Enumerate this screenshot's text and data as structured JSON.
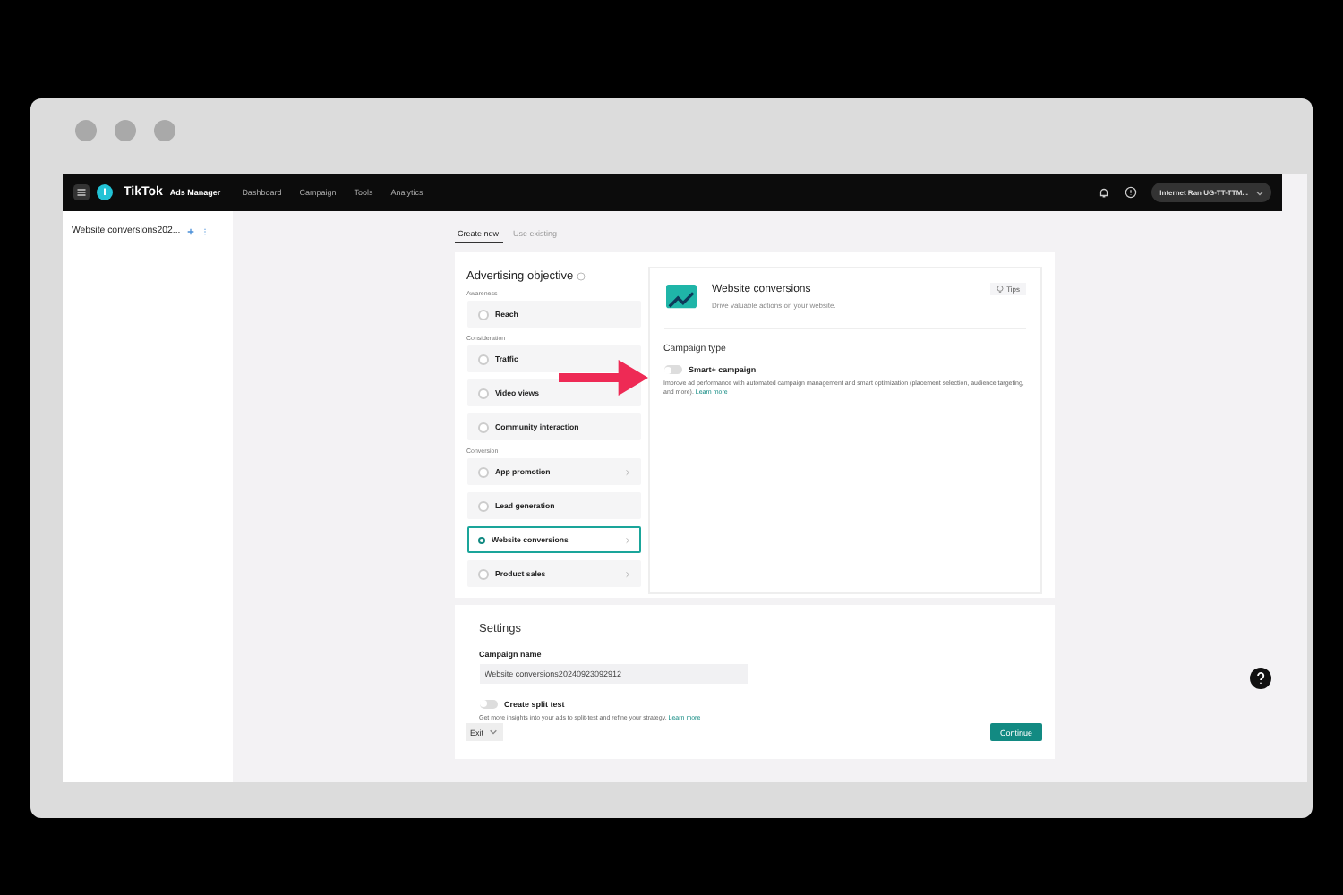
{
  "nav": {
    "brand": "TikTok",
    "product": "Ads Manager",
    "items": [
      "Dashboard",
      "Campaign",
      "Tools",
      "Analytics"
    ],
    "account": "Internet Ran UG-TT-TTM..."
  },
  "sidebar": {
    "campaign": "Website conversions202..."
  },
  "tabs": [
    {
      "label": "Create new",
      "selected": true
    },
    {
      "label": "Use existing",
      "selected": false
    }
  ],
  "objective": {
    "title": "Advertising objective",
    "groups": [
      {
        "label": "Awareness",
        "options": [
          {
            "label": "Reach",
            "selected": false,
            "expandable": false
          }
        ]
      },
      {
        "label": "Consideration",
        "options": [
          {
            "label": "Traffic",
            "selected": false,
            "expandable": false
          },
          {
            "label": "Video views",
            "selected": false,
            "expandable": false
          },
          {
            "label": "Community interaction",
            "selected": false,
            "expandable": false
          }
        ]
      },
      {
        "label": "Conversion",
        "options": [
          {
            "label": "App promotion",
            "selected": false,
            "expandable": true
          },
          {
            "label": "Lead generation",
            "selected": false,
            "expandable": false
          },
          {
            "label": "Website conversions",
            "selected": true,
            "expandable": true
          },
          {
            "label": "Product sales",
            "selected": false,
            "expandable": true
          }
        ]
      }
    ]
  },
  "detail": {
    "title": "Website conversions",
    "subtitle": "Drive valuable actions on your website.",
    "tips": "Tips",
    "type_heading": "Campaign type",
    "smart": {
      "label": "Smart+ campaign",
      "on": false
    },
    "description": "Improve ad performance with automated campaign management and smart optimization (placement selection, audience targeting, and more).",
    "link": "Learn more"
  },
  "settings": {
    "title": "Settings",
    "name_label": "Campaign name",
    "name_value": "Website conversions20240923092912",
    "split": {
      "label": "Create split test",
      "on": false
    },
    "description": "Get more insights into your ads to split-test and refine your strategy.",
    "link": "Learn more"
  },
  "footer": {
    "exit": "Exit",
    "continue": "Continue"
  }
}
